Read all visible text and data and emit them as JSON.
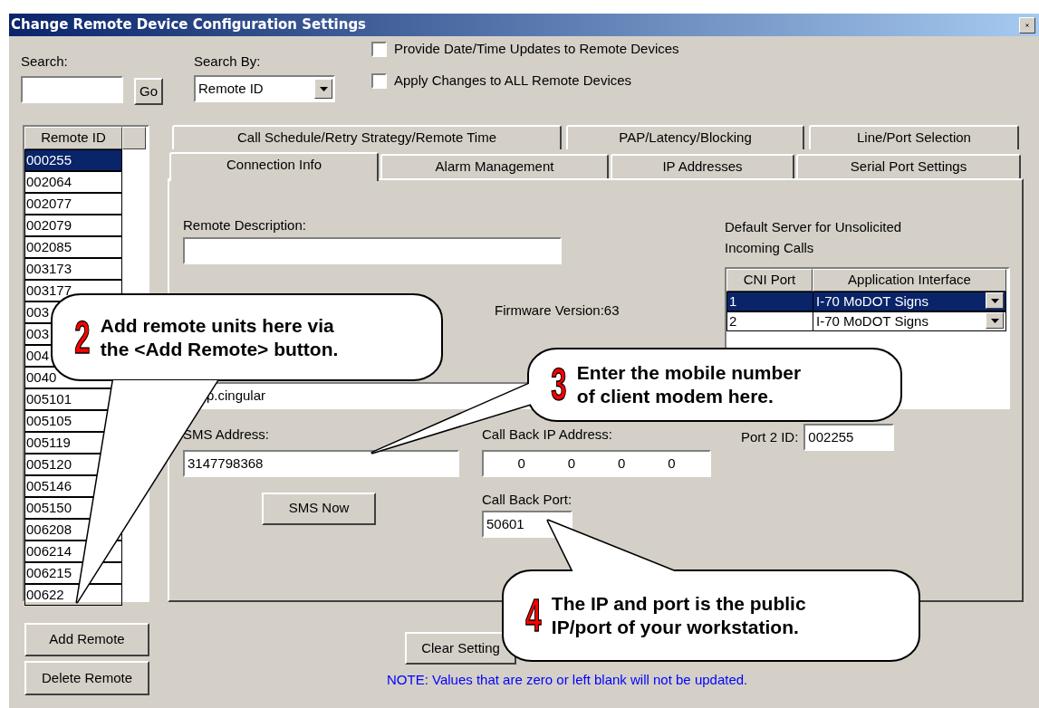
{
  "window": {
    "title": "Change Remote Device Configuration Settings"
  },
  "search": {
    "label": "Search:",
    "button": "Go"
  },
  "search_by": {
    "label": "Search By:",
    "value": "Remote ID"
  },
  "options": [
    {
      "label": "Provide Date/Time Updates to Remote Devices",
      "checked": false
    },
    {
      "label": "Apply Changes to ALL Remote Devices",
      "checked": false
    }
  ],
  "remote_list": {
    "column": "Remote ID",
    "items": [
      {
        "id": "000255",
        "selected": true
      },
      {
        "id": "002064",
        "selected": false
      },
      {
        "id": "002077",
        "selected": false
      },
      {
        "id": "002079",
        "selected": false
      },
      {
        "id": "002085",
        "selected": false
      },
      {
        "id": "003173",
        "selected": false
      },
      {
        "id": "003177",
        "selected": false
      },
      {
        "id": "003",
        "selected": false
      },
      {
        "id": "003",
        "selected": false
      },
      {
        "id": "004",
        "selected": false
      },
      {
        "id": "0040",
        "selected": false
      },
      {
        "id": "005101",
        "selected": false
      },
      {
        "id": "005105",
        "selected": false
      },
      {
        "id": "005119",
        "selected": false
      },
      {
        "id": "005120",
        "selected": false
      },
      {
        "id": "005146",
        "selected": false
      },
      {
        "id": "005150",
        "selected": false
      },
      {
        "id": "006208",
        "selected": false
      },
      {
        "id": "006214",
        "selected": false
      },
      {
        "id": "006215",
        "selected": false
      },
      {
        "id": "00622",
        "selected": false
      }
    ]
  },
  "tabs": {
    "back_row": [
      {
        "label": "Call Schedule/Retry Strategy/Remote Time",
        "selected": false
      },
      {
        "label": "PAP/Latency/Blocking",
        "selected": false
      },
      {
        "label": "Line/Port Selection",
        "selected": false
      }
    ],
    "front_row": [
      {
        "label": "Connection Info",
        "selected": true
      },
      {
        "label": "Alarm Management",
        "selected": false
      },
      {
        "label": "IP Addresses",
        "selected": false
      },
      {
        "label": "Serial Port Settings",
        "selected": false
      }
    ]
  },
  "connection_info": {
    "remote_description": {
      "label": "Remote Description:"
    },
    "firmware": "Firmware Version:63",
    "apn_value": "p.cingular",
    "sms_address": {
      "label": "SMS Address:",
      "value": "3147798368"
    },
    "sms_button": "SMS Now",
    "callback_ip": {
      "label": "Call Back IP Address:",
      "octets": [
        "0",
        "0",
        "0",
        "0"
      ]
    },
    "callback_port": {
      "label": "Call Back Port:",
      "value": "50601"
    },
    "default_server": {
      "label": "Default Server for Unsolicited Incoming Calls",
      "columns": [
        "CNI Port",
        "Application Interface"
      ],
      "rows": [
        {
          "port": "1",
          "interface": "I-70 MoDOT Signs",
          "selected": true
        },
        {
          "port": "2",
          "interface": "I-70 MoDOT Signs",
          "selected": false
        }
      ]
    },
    "port2": {
      "label": "Port 2 ID:",
      "value": "002255"
    }
  },
  "buttons": {
    "add_remote": "Add Remote",
    "delete_remote": "Delete Remote",
    "clear_settings": "Clear Setting"
  },
  "note": "NOTE: Values that are zero or left blank will not be updated.",
  "callouts": [
    {
      "number": "2",
      "text": "Add remote units here via the <Add Remote> button."
    },
    {
      "number": "3",
      "text": "Enter the mobile number of client modem here."
    },
    {
      "number": "4",
      "text": "The IP and port is the public IP/port of your workstation."
    }
  ]
}
